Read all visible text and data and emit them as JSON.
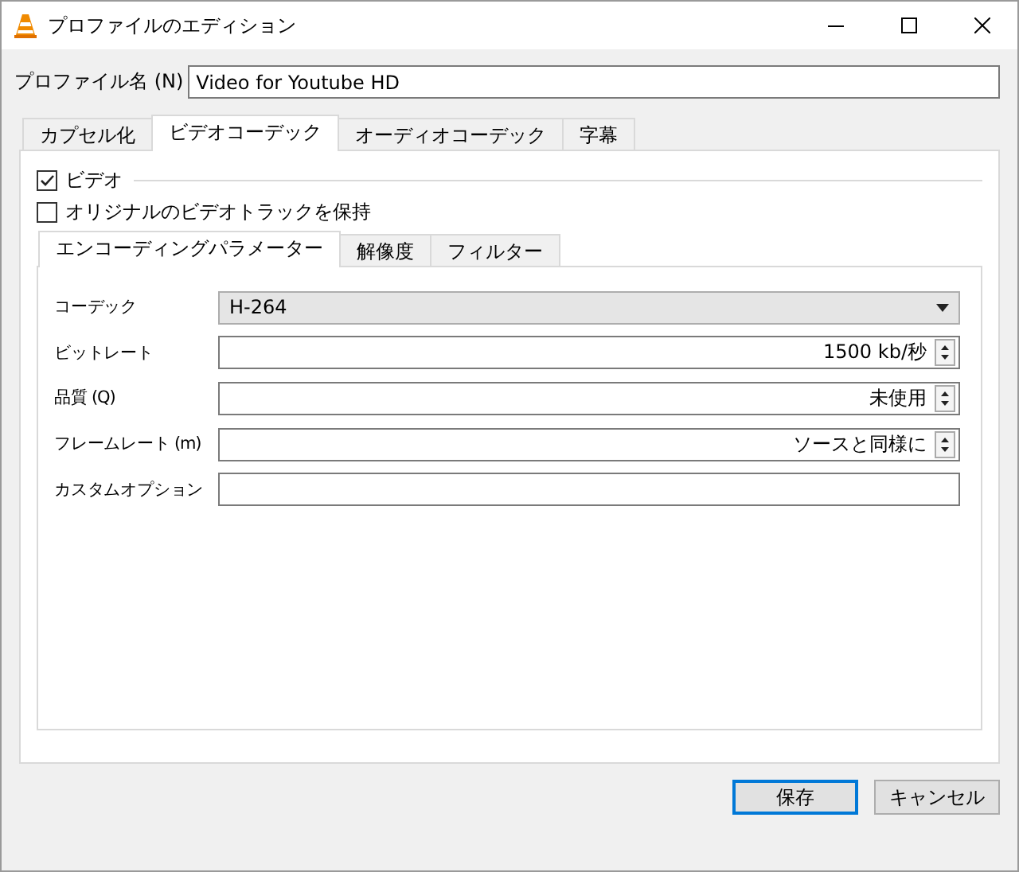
{
  "window": {
    "title": "プロファイルのエディション"
  },
  "profile_name": {
    "label": "プロファイル名 (N)",
    "value": "Video for Youtube HD"
  },
  "tabs": [
    {
      "label": "カプセル化",
      "selected": false
    },
    {
      "label": "ビデオコーデック",
      "selected": true
    },
    {
      "label": "オーディオコーデック",
      "selected": false
    },
    {
      "label": "字幕",
      "selected": false
    }
  ],
  "video": {
    "label": "ビデオ",
    "checked": true
  },
  "keep_original": {
    "label": "オリジナルのビデオトラックを保持",
    "checked": false
  },
  "subtabs": [
    {
      "label": "エンコーディングパラメーター",
      "selected": true
    },
    {
      "label": "解像度",
      "selected": false
    },
    {
      "label": "フィルター",
      "selected": false
    }
  ],
  "fields": [
    {
      "kind": "combo",
      "label": "コーデック",
      "value": "H-264"
    },
    {
      "kind": "spin",
      "label": "ビットレート",
      "value": "1500 kb/秒"
    },
    {
      "kind": "spin",
      "label": "品質 (Q)",
      "value": "未使用"
    },
    {
      "kind": "spin",
      "label": "フレームレート (m)",
      "value": "ソースと同様に"
    },
    {
      "kind": "text",
      "label": "カスタムオプション"
    }
  ],
  "buttons": [
    {
      "label": "保存",
      "kind": "default"
    },
    {
      "label": "キャンセル",
      "kind": "normal"
    }
  ]
}
